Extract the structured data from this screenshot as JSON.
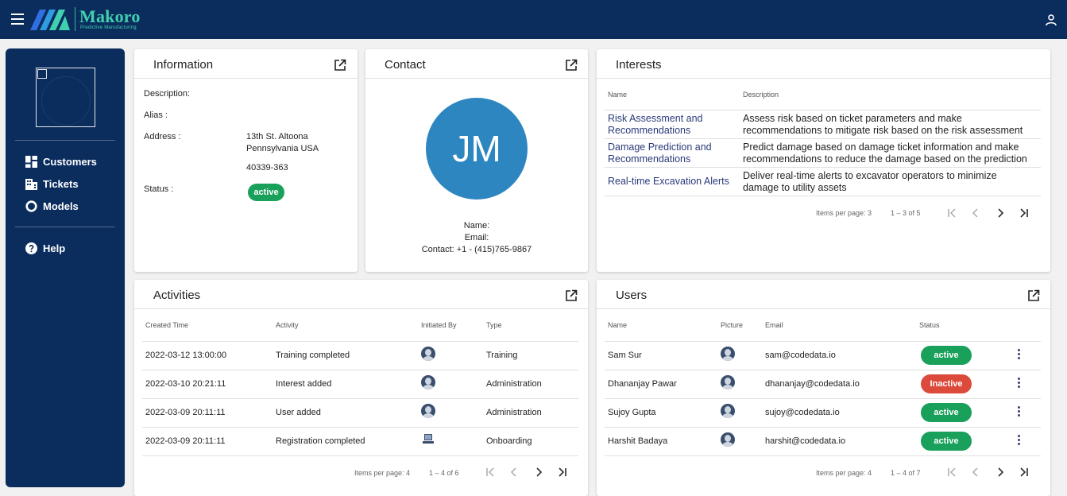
{
  "header": {
    "brand": "Makoro",
    "tagline": "Predictive Manufacturing",
    "menu_icon": "hamburger-icon",
    "user_icon": "person-icon"
  },
  "sidebar": {
    "items": [
      {
        "label": "Customers",
        "icon": "dashboard-icon"
      },
      {
        "label": "Tickets",
        "icon": "building-icon"
      },
      {
        "label": "Models",
        "icon": "circle-icon"
      },
      {
        "label": "Help",
        "icon": "help-icon"
      }
    ]
  },
  "information": {
    "title": "Information",
    "description_label": "Description:",
    "alias_label": "Alias :",
    "address_label": "Address :",
    "address_line1": "13th St. Altoona",
    "address_line2": "Pennsylvania USA",
    "address_line3": "40339-363",
    "status_label": "Status :",
    "status_value": "active"
  },
  "contact": {
    "title": "Contact",
    "initials": "JM",
    "name_label": "Name:",
    "email_label": "Email:",
    "contact_label": "Contact: +1 - (415)765-9867"
  },
  "interests": {
    "title": "Interests",
    "columns": [
      "Name",
      "Description"
    ],
    "rows": [
      {
        "name_1": "Risk Assessment and",
        "name_2": "Recommendations",
        "desc_1": "Assess risk based on ticket parameters and make",
        "desc_2": "recommendations to mitigate risk based on the risk assessment"
      },
      {
        "name_1": "Damage Prediction and",
        "name_2": "Recommendations",
        "desc_1": "Predict damage based on damage ticket information and make",
        "desc_2": "recommendations to reduce the damage based on the prediction"
      },
      {
        "name_1": "Real-time Excavation Alerts",
        "name_2": "",
        "desc_1": "Deliver real-time alerts to excavator operators to minimize",
        "desc_2": "damage to utility assets"
      }
    ],
    "items_per_page": "Items per page: 3",
    "range": "1 – 3 of 5"
  },
  "activities": {
    "title": "Activities",
    "columns": [
      "Created Time",
      "Activity",
      "Initiated By",
      "Type"
    ],
    "rows": [
      {
        "time": "2022-03-12 13:00:00",
        "activity": "Training completed",
        "initiator": "person-icon",
        "type": "Training"
      },
      {
        "time": "2022-03-10 20:21:11",
        "activity": "Interest added",
        "initiator": "person-icon",
        "type": "Administration"
      },
      {
        "time": "2022-03-09 20:11:11",
        "activity": "User added",
        "initiator": "person-icon",
        "type": "Administration"
      },
      {
        "time": "2022-03-09 20:11:11",
        "activity": "Registration completed",
        "initiator": "computer-icon",
        "type": "Onboarding"
      }
    ],
    "items_per_page": "Items per page: 4",
    "range": "1 – 4 of 6"
  },
  "users": {
    "title": "Users",
    "columns": [
      "Name",
      "Picture",
      "Email",
      "Status"
    ],
    "rows": [
      {
        "name": "Sam Sur",
        "email": "sam@codedata.io",
        "status": "active"
      },
      {
        "name": "Dhananjay Pawar",
        "email": "dhananjay@codedata.io",
        "status": "Inactive"
      },
      {
        "name": "Sujoy Gupta",
        "email": "sujoy@codedata.io",
        "status": "active"
      },
      {
        "name": "Harshit Badaya",
        "email": "harshit@codedata.io",
        "status": "active"
      }
    ],
    "items_per_page": "Items per page: 4",
    "range": "1 – 4 of 7"
  },
  "colors": {
    "navy": "#0b2d5e",
    "teal": "#3fd0b0",
    "active": "#19a05a",
    "inactive": "#db4a3b",
    "avatar": "#2e86c1",
    "link": "#2a3a7a"
  }
}
